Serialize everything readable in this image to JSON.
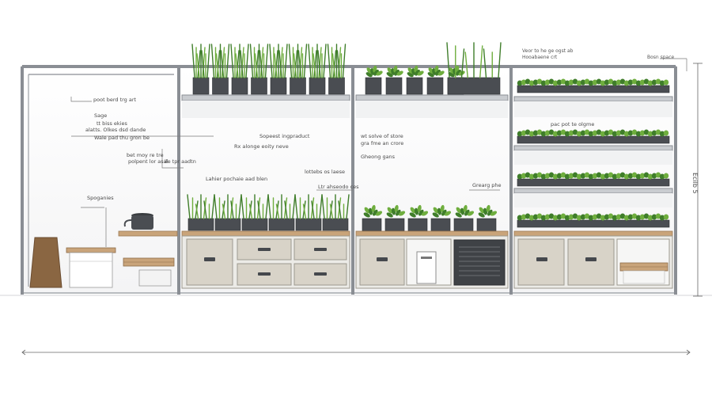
{
  "labels": {
    "l1": "poot berd trg art",
    "l2": "Sage",
    "l3": "tt biss ekies",
    "l4": "alatts. Olkes dsd dande",
    "l5": "Wale pad thu gron be",
    "l6": "Sopeest ingpraduct",
    "l7": "Rx alonge eoity neve",
    "l8": "bet moy re tre",
    "l9": "polpent lor asal",
    "l10": "ile tpr aadtn",
    "l11": "Lahier pochaie aad blen",
    "l12": "Spoganies",
    "l13": "wt solve of store",
    "l14": "gra fme an crore",
    "l15": "Gheong gans",
    "l16": "lottebs os laese",
    "l17": "Ltr ahseodo ces",
    "l18": "Grearg phe",
    "l19": "Veor to he ge ogst ab",
    "l20": "Hooabaene crt",
    "l21": "Bosn space",
    "l22": "pac pot te olgme",
    "l23": "Ecilb 5"
  },
  "colors": {
    "frame": "#8a8e94",
    "frame_dark": "#5d6167",
    "shelf": "#c9ccd0",
    "counter_top": "#c9a47a",
    "cabinet": "#d8d3c8",
    "cabinet_edge": "#9d998f",
    "pot": "#4a4d52",
    "plant_light": "#6fae3e",
    "plant_dark": "#3f7d2a",
    "sack": "#8a6642",
    "dark_unit": "#3f4246"
  }
}
